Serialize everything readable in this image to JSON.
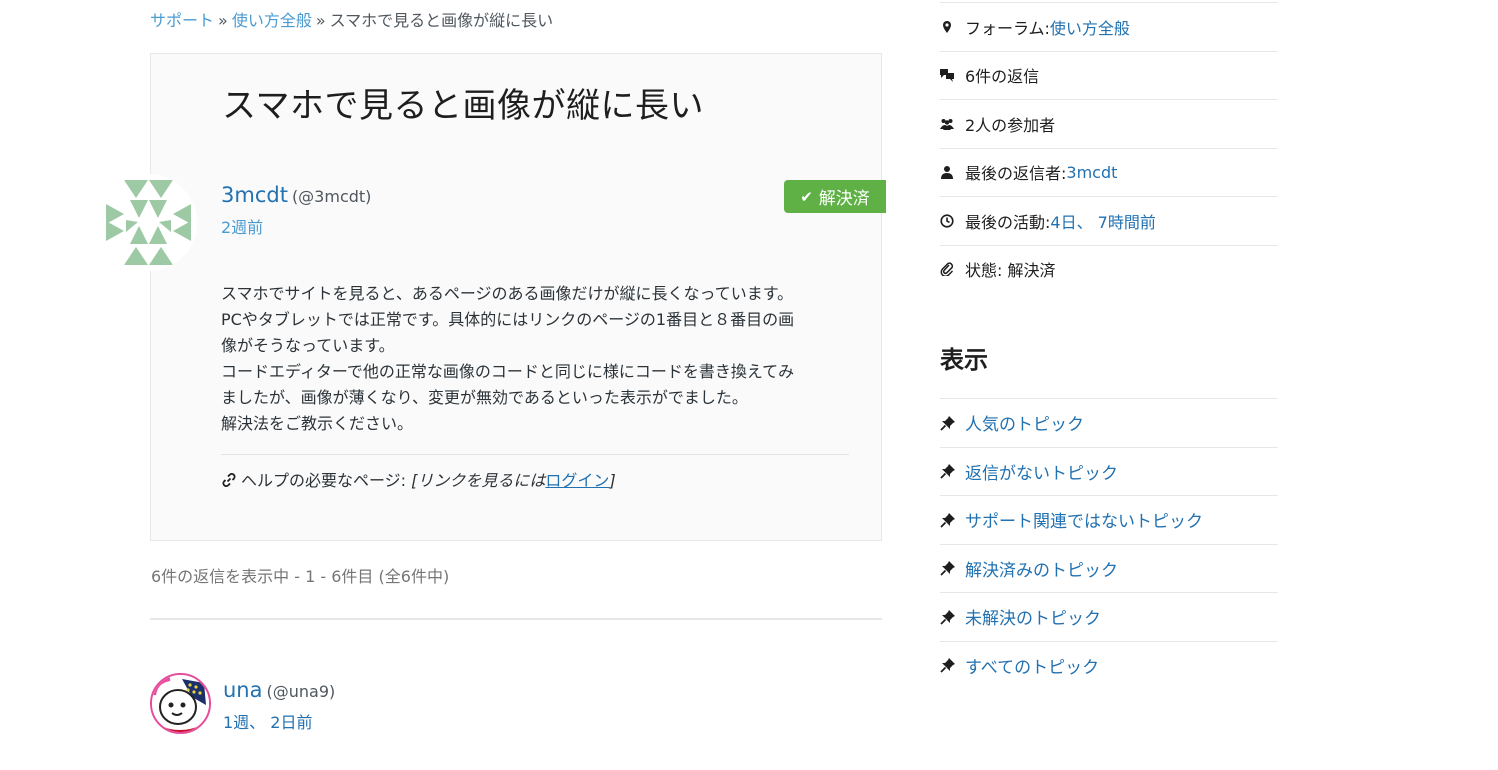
{
  "breadcrumb": {
    "items": [
      "サポート",
      "使い方全般",
      "スマホで見ると画像が縦に長い"
    ],
    "separator": "»"
  },
  "topic": {
    "title": "スマホで見ると画像が縦に長い",
    "author": "3mcdt",
    "handle": "(@3mcdt)",
    "time": "2週前",
    "badge": "解決済",
    "body": [
      "スマホでサイトを見ると、あるページのある画像だけが縦に長くなっています。",
      "PCやタブレットでは正常です。具体的にはリンクのページの1番目と８番目の画",
      "像がそうなっています。",
      "コードエディターで他の正常な画像のコードと同じに様にコードを書き換えてみ",
      "ましたが、画像が薄くなり、変更が無効であるといった表示がでました。",
      "解決法をご教示ください。"
    ],
    "help_label": "ヘルプの必要なページ:",
    "help_prefix": "[リンクを見るには",
    "help_login": "ログイン",
    "help_suffix": "]"
  },
  "replies_summary": "6件の返信を表示中 - 1 - 6件目 (全6件中)",
  "reply": {
    "author": "una",
    "handle": "(@una9)",
    "time": "1週、 2日前"
  },
  "sidebar": {
    "meta": [
      {
        "icon": "location-icon",
        "label": "フォーラム: ",
        "value": "使い方全般"
      },
      {
        "icon": "replies-icon",
        "label": "6件の返信",
        "value": ""
      },
      {
        "icon": "participants-icon",
        "label": "2人の参加者",
        "value": ""
      },
      {
        "icon": "user-icon",
        "label": "最後の返信者: ",
        "value": "3mcdt"
      },
      {
        "icon": "clock-icon",
        "label": "最後の活動: ",
        "value": "4日、 7時間前"
      },
      {
        "icon": "paperclip-icon",
        "label": "状態: 解決済",
        "value": ""
      }
    ],
    "views_title": "表示",
    "views": [
      "人気のトピック",
      "返信がないトピック",
      "サポート関連ではないトピック",
      "解決済みのトピック",
      "未解決のトピック",
      "すべてのトピック"
    ]
  },
  "colors": {
    "link": "#2271b1",
    "badge": "#5fb146"
  }
}
